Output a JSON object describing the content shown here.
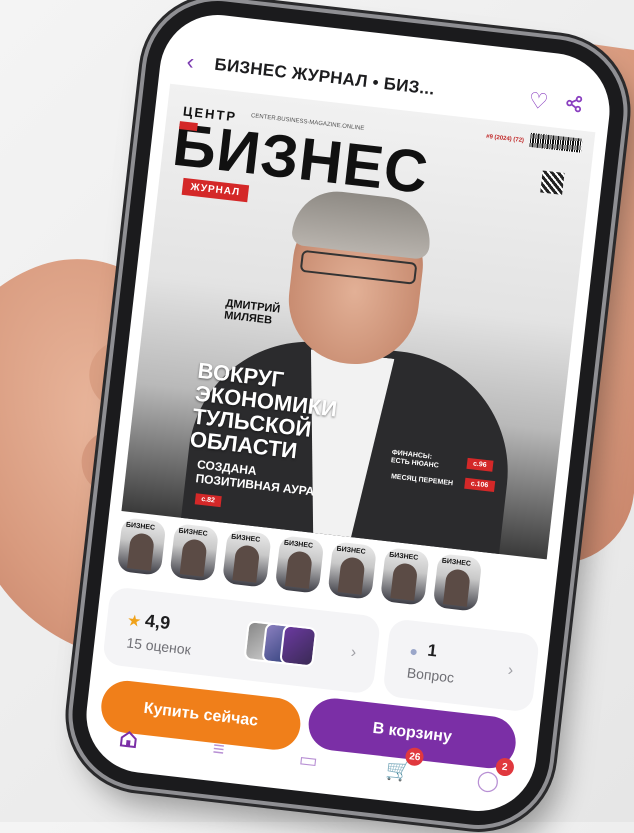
{
  "header": {
    "back_icon": "chevron-left-icon",
    "title": "БИЗНЕС ЖУРНАЛ • БИЗ...",
    "favorite_icon": "heart-icon",
    "share_icon": "share-icon"
  },
  "cover": {
    "brand_top": "ЦЕНТР",
    "brand_site": "CENTER.BUSINESS-MAGAZINE.ONLINE",
    "issue": "#9 (2024) (72)",
    "brand_big": "БИЗНЕС",
    "journal_label": "ЖУРНАЛ",
    "person_name_1": "ДМИТРИЙ",
    "person_name_2": "МИЛЯЕВ",
    "headline_1": "ВОКРУГ",
    "headline_2": "ЭКОНОМИКИ",
    "headline_3": "ТУЛЬСКОЙ",
    "headline_4": "ОБЛАСТИ",
    "subhead_1": "СОЗДАНА",
    "subhead_2": "ПОЗИТИВНАЯ АУРА",
    "page_main": "с.82",
    "side1_1": "ФИНАНСЫ:",
    "side1_2": "ЕСТЬ НЮАНС",
    "side1_page": "с.96",
    "side2": "МЕСЯЦ ПЕРЕМЕН",
    "side2_page": "с.106"
  },
  "thumbnails": [
    {
      "label": "БИЗНЕС"
    },
    {
      "label": "БИЗНЕС"
    },
    {
      "label": "БИЗНЕС"
    },
    {
      "label": "БИЗНЕС"
    },
    {
      "label": "БИЗНЕС"
    },
    {
      "label": "БИЗНЕС"
    },
    {
      "label": "БИЗНЕС"
    }
  ],
  "rating": {
    "star_icon": "star-icon",
    "value": "4,9",
    "count": "15 оценок"
  },
  "questions": {
    "icon": "chat-bubble-icon",
    "count": "1",
    "label": "Вопрос"
  },
  "actions": {
    "buy_now": "Купить сейчас",
    "add_to_cart": "В корзину"
  },
  "tabbar": {
    "home_icon": "home-icon",
    "catalog_icon": "search-list-icon",
    "wallet_icon": "wallet-icon",
    "cart_icon": "cart-icon",
    "cart_badge": "26",
    "profile_icon": "profile-icon",
    "profile_badge": "2"
  },
  "colors": {
    "accent_purple": "#7b2fa6",
    "accent_orange": "#f07f1a",
    "cover_red": "#d42828",
    "badge_red": "#e0383e"
  }
}
